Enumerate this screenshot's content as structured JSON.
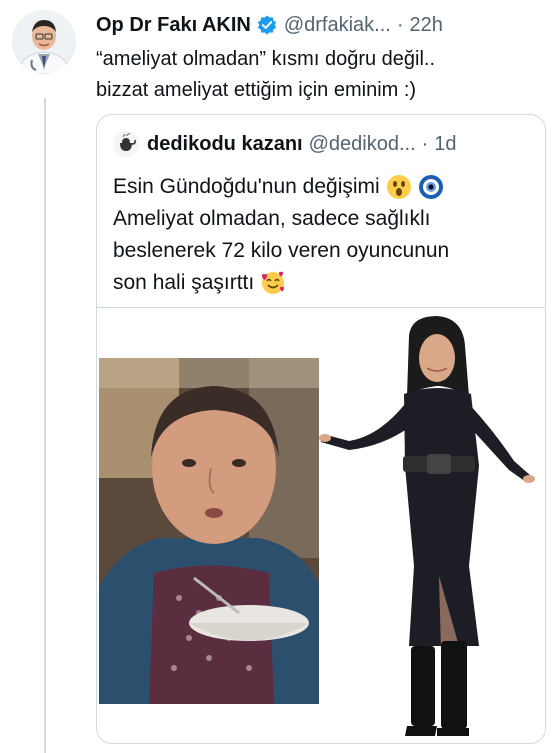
{
  "tweet": {
    "author": {
      "display_name": "Op Dr Fakı AKIN",
      "handle": "@drfakiak...",
      "avatar_icon": "doctor-avatar",
      "verified_icon": "verified-badge-icon",
      "verified_color": "#1d9bf0"
    },
    "separator": "·",
    "time": "22h",
    "text_lines": [
      "“ameliyat olmadan” kısmı doğru değil..",
      "bizzat ameliyat ettiğim için eminim :)"
    ]
  },
  "quoted_tweet": {
    "author": {
      "display_name": "dedikodu kazanı",
      "handle": "@dedikod...",
      "avatar_icon": "kettle-logo-avatar"
    },
    "separator": "·",
    "time": "1d",
    "text_lines": [
      "Esin Gündoğdu'nun değişimi",
      "Ameliyat olmadan, sadece sağlıklı",
      "beslenerek 72 kilo veren oyuncunun",
      "son hali şaşırttı"
    ],
    "emojis": {
      "line1": [
        "astonished-face-emoji",
        "nazar-amulet-emoji"
      ],
      "line4": [
        "smiling-face-with-hearts-emoji"
      ]
    },
    "media": {
      "left_image": "before-photo",
      "right_image": "after-photo"
    }
  },
  "colors": {
    "text_primary": "#0f1419",
    "text_secondary": "#536471",
    "border": "#cfd9de",
    "accent": "#1d9bf0"
  }
}
